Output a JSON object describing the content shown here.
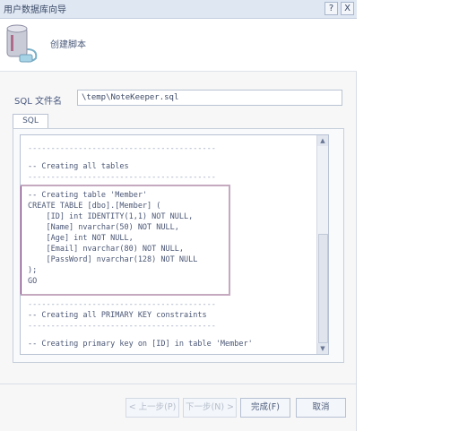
{
  "window": {
    "title": "用户数据库向导",
    "minimize_label": "?",
    "close_label": "X"
  },
  "header": {
    "title": "创建脚本"
  },
  "path": {
    "label": "SQL 文件名",
    "value": "\\temp\\NoteKeeper.sql"
  },
  "tab": {
    "label": "SQL"
  },
  "editor": {
    "lines": [
      "-----------------------------------------",
      "-- Creating all tables",
      "-----------------------------------------",
      "-- Creating table 'Member'",
      "CREATE TABLE [dbo].[Member] (",
      "    [ID] int IDENTITY(1,1) NOT NULL,",
      "    [Name] nvarchar(50) NOT NULL,",
      "    [Age] int NOT NULL,",
      "    [Email] nvarchar(80) NOT NULL,",
      "    [PassWord] nvarchar(128) NOT NULL",
      ");",
      "GO",
      "-----------------------------------------",
      "-- Creating all PRIMARY KEY constraints",
      "-----------------------------------------",
      "-- Creating primary key on [ID] in table 'Member'"
    ]
  },
  "buttons": {
    "prev": "< 上一步(P)",
    "next": "下一步(N) >",
    "finish": "完成(F)",
    "cancel": "取消"
  }
}
